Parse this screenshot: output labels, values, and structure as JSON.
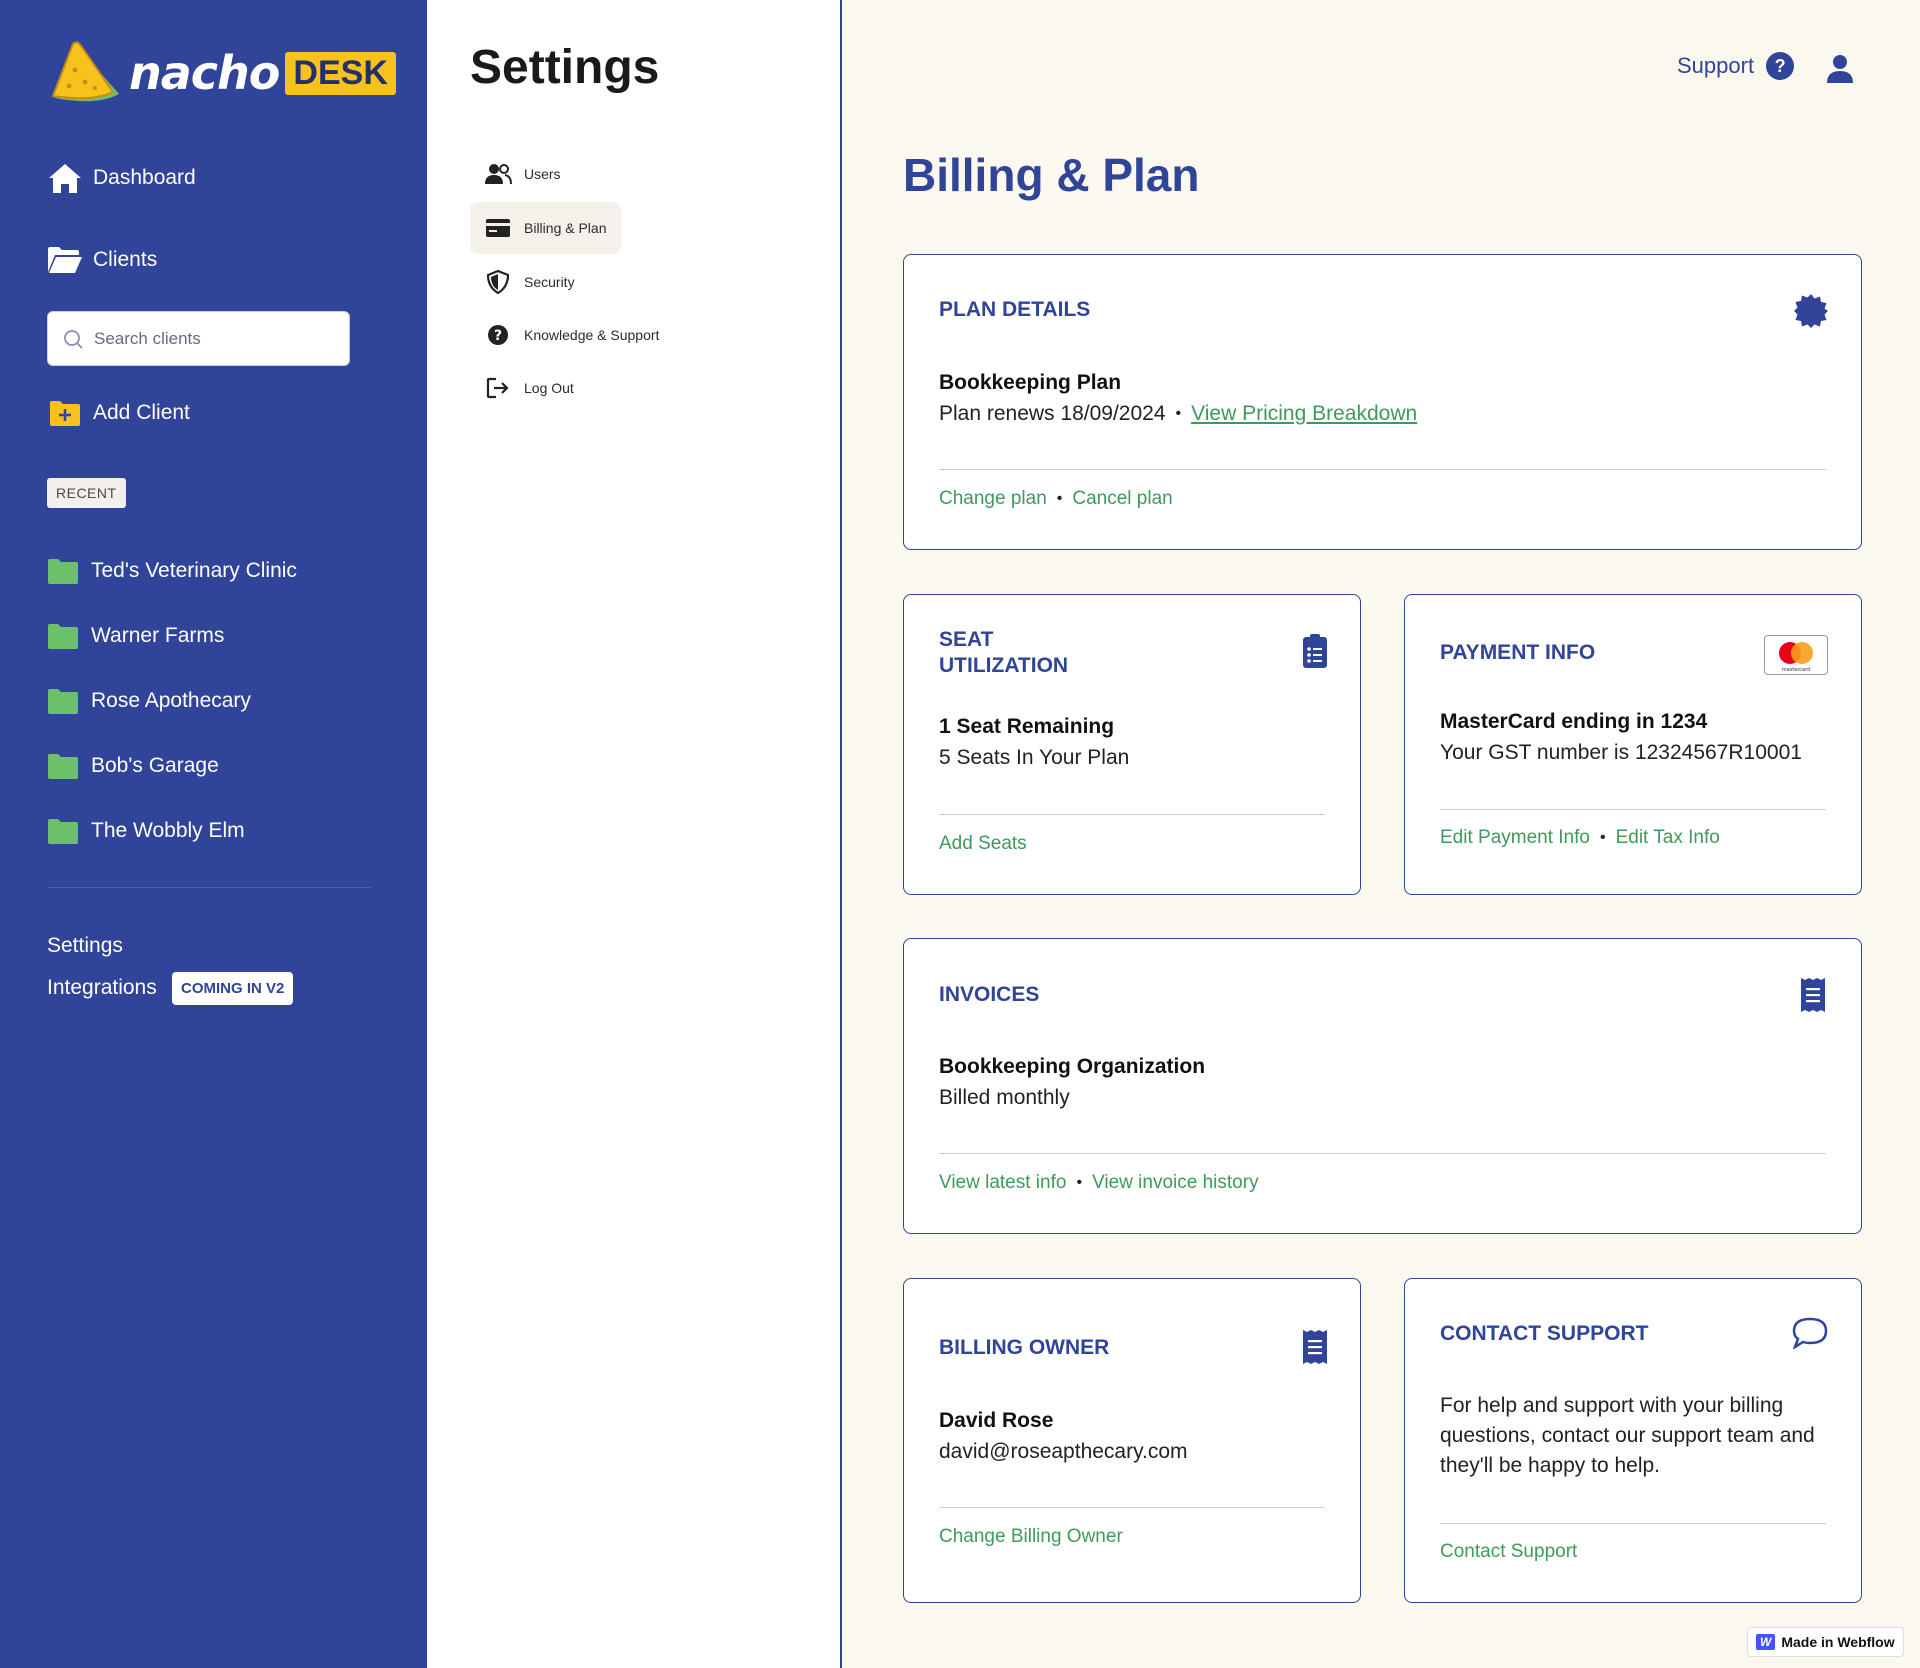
{
  "brand": {
    "word": "nacho",
    "desk": "DESK"
  },
  "sidebar": {
    "dashboard": "Dashboard",
    "clients": "Clients",
    "search_placeholder": "Search clients",
    "add_client": "Add Client",
    "recent_label": "RECENT",
    "recent_clients": [
      "Ted's Veterinary Clinic",
      "Warner Farms",
      "Rose Apothecary",
      "Bob's Garage",
      "The Wobbly Elm"
    ],
    "settings": "Settings",
    "integrations": "Integrations",
    "integrations_badge": "COMING IN V2"
  },
  "settings_menu": {
    "title": "Settings",
    "items": [
      "Users",
      "Billing & Plan",
      "Security",
      "Knowledge & Support",
      "Log Out"
    ],
    "active": "Billing & Plan"
  },
  "header": {
    "support": "Support",
    "help_glyph": "?"
  },
  "page": {
    "title": "Billing & Plan"
  },
  "plan_details": {
    "title": "PLAN DETAILS",
    "plan_name": "Bookkeeping Plan",
    "renews": "Plan renews 18/09/2024",
    "pricing_link": "View Pricing Breakdown",
    "change": "Change plan",
    "cancel": "Cancel plan"
  },
  "seat_utilization": {
    "title_line1": "SEAT",
    "title_line2": "UTILIZATION",
    "remaining": "1 Seat Remaining",
    "total": "5 Seats In Your Plan",
    "add": "Add Seats"
  },
  "payment_info": {
    "title": "PAYMENT INFO",
    "card": "MasterCard ending in 1234",
    "gst": "Your GST number is 12324567R10001",
    "edit_payment": "Edit Payment Info",
    "edit_tax": "Edit Tax Info",
    "card_brand_label": "mastercard"
  },
  "invoices": {
    "title": "INVOICES",
    "org": "Bookkeeping Organization",
    "billing": "Billed monthly",
    "latest": "View latest info",
    "history": "View invoice history"
  },
  "billing_owner": {
    "title": "BILLING OWNER",
    "name": "David Rose",
    "email": "david@roseapthecary.com",
    "change": "Change Billing Owner"
  },
  "contact_support": {
    "title": "CONTACT SUPPORT",
    "text": "For help and support with your billing questions, contact our support team and they'll be happy to help.",
    "link": "Contact Support"
  },
  "webflow_badge": {
    "mark": "W",
    "text": "Made in Webflow"
  },
  "colors": {
    "primary": "#30449a",
    "accent_green": "#3e9a5a",
    "folder_green": "#6cc06a",
    "logo_yellow": "#f7c21c",
    "background": "#fbf8ef"
  },
  "icons": [
    "home-icon",
    "folder-open-icon",
    "search-icon",
    "folder-plus-icon",
    "folder-icon",
    "users-icon",
    "credit-card-icon",
    "shield-icon",
    "help-icon",
    "logout-icon",
    "user-icon",
    "badge-icon",
    "clipboard-list-icon",
    "mastercard-icon",
    "receipt-icon",
    "chat-bubble-icon"
  ]
}
